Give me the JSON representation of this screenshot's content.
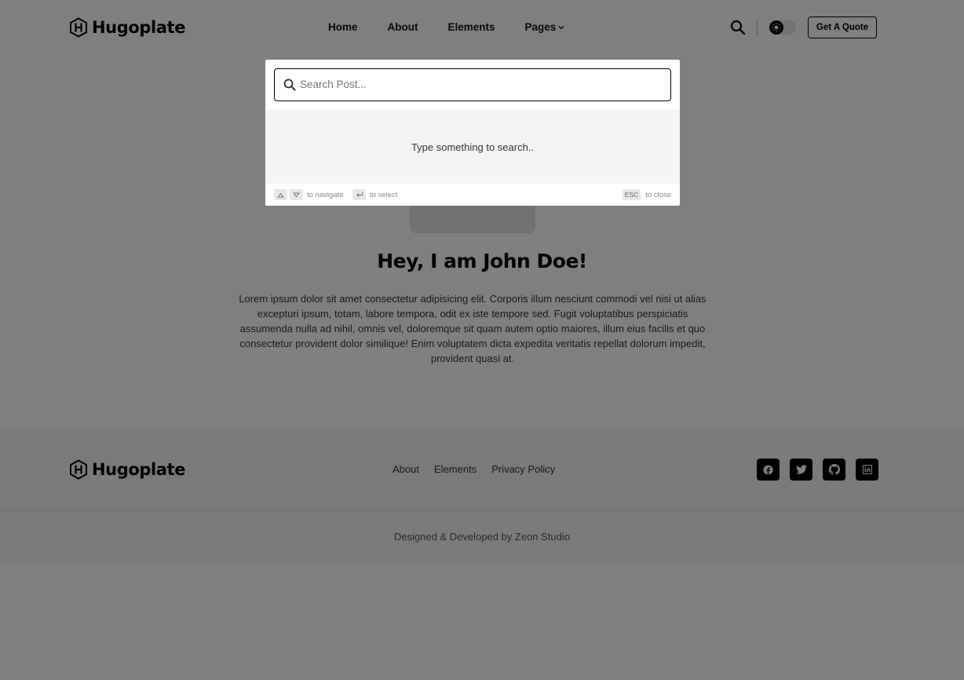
{
  "brand": {
    "name": "Hugoplate"
  },
  "nav": {
    "items": [
      {
        "label": "Home"
      },
      {
        "label": "About"
      },
      {
        "label": "Elements"
      },
      {
        "label": "Pages"
      }
    ],
    "cta_label": "Get A Quote"
  },
  "hero": {
    "title": "Hey, I am John Doe!",
    "text": "Lorem ipsum dolor sit amet consectetur adipisicing elit. Corporis illum nesciunt commodi vel nisi ut alias excepturi ipsum, totam, labore tempora, odit ex iste tempore sed. Fugit voluptatibus perspiciatis assumenda nulla ad nihil, omnis vel, doloremque sit quam autem optio maiores, illum eius facilis et quo consectetur provident dolor similique! Enim voluptatem dicta expedita veritatis repellat dolorum impedit, provident quasi at."
  },
  "footer": {
    "links": [
      {
        "label": "About"
      },
      {
        "label": "Elements"
      },
      {
        "label": "Privacy Policy"
      }
    ],
    "socials": [
      "facebook-icon",
      "twitter-icon",
      "github-icon",
      "linkedin-icon"
    ],
    "copyright": "Designed & Developed by Zeon Studio"
  },
  "search_modal": {
    "placeholder": "Search Post...",
    "empty_message": "Type something to search..",
    "hint_navigate": "to navigate",
    "hint_select": "to select",
    "esc_key": "ESC",
    "hint_close": "to close"
  },
  "colors": {
    "overlay": "rgba(0,0,0,0.5)",
    "accent": "#000000",
    "results_bg": "#f3f4f6"
  }
}
